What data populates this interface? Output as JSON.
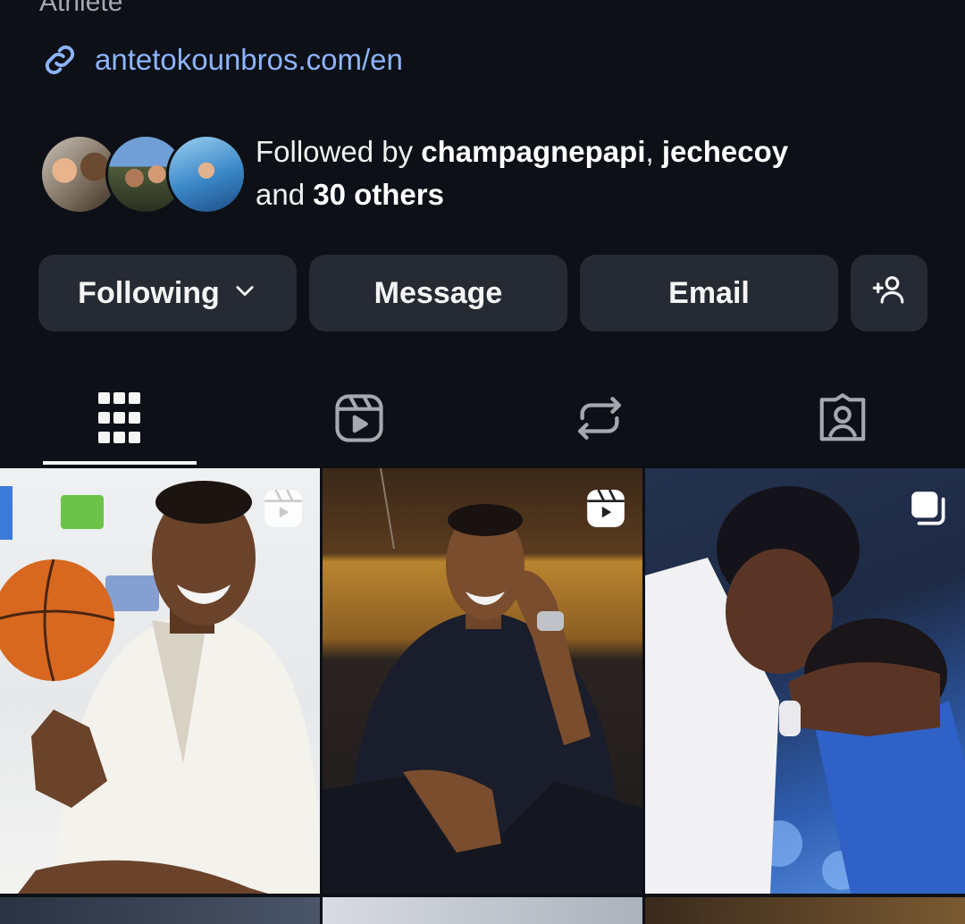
{
  "profile": {
    "category": "Athlete",
    "link": "antetokounbros.com/en",
    "followed_by": {
      "prefix": "Followed by ",
      "user1": "champagnepapi",
      "sep": ", ",
      "user2": "jechecoy",
      "and": "and ",
      "others": "30 others"
    }
  },
  "actions": {
    "following": "Following",
    "message": "Message",
    "email": "Email"
  },
  "tabs": [
    {
      "icon": "grid-icon",
      "active": true
    },
    {
      "icon": "reels-icon",
      "active": false
    },
    {
      "icon": "reposts-icon",
      "active": false
    },
    {
      "icon": "tagged-icon",
      "active": false
    }
  ],
  "posts": [
    {
      "type": "reel",
      "badge": "reel-icon"
    },
    {
      "type": "reel",
      "badge": "reel-icon"
    },
    {
      "type": "carousel",
      "badge": "carousel-icon"
    }
  ],
  "colors": {
    "background": "#0d1016",
    "button": "#262a32",
    "link": "#8cb4ff"
  }
}
